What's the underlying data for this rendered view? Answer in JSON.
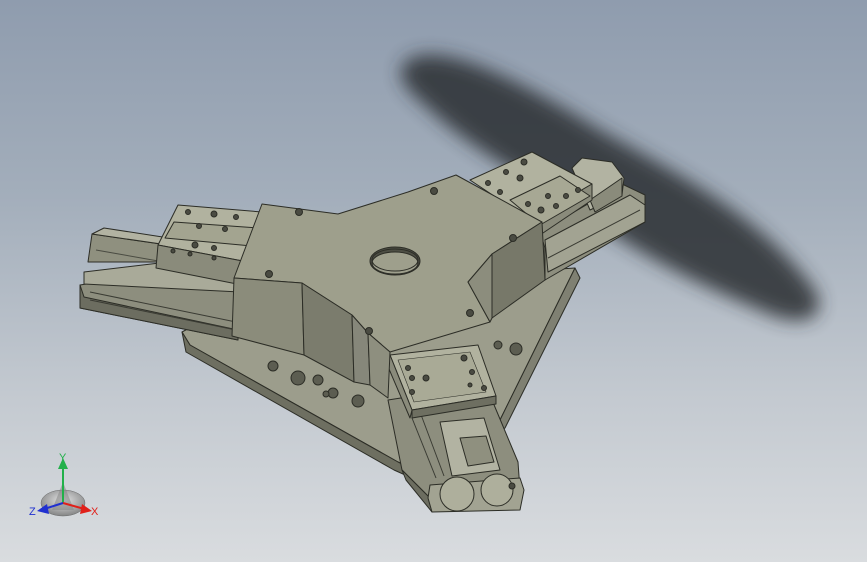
{
  "viewport": {
    "background_top": "#8f9cae",
    "background_bottom": "#d9dcdf",
    "model_color": "#9fa08f",
    "shadow_color": "#2a2d30"
  },
  "triad": {
    "x_label": "X",
    "y_label": "Y",
    "z_label": "Z",
    "x_color": "#e0201a",
    "y_color": "#22b04a",
    "z_color": "#2030d0"
  }
}
